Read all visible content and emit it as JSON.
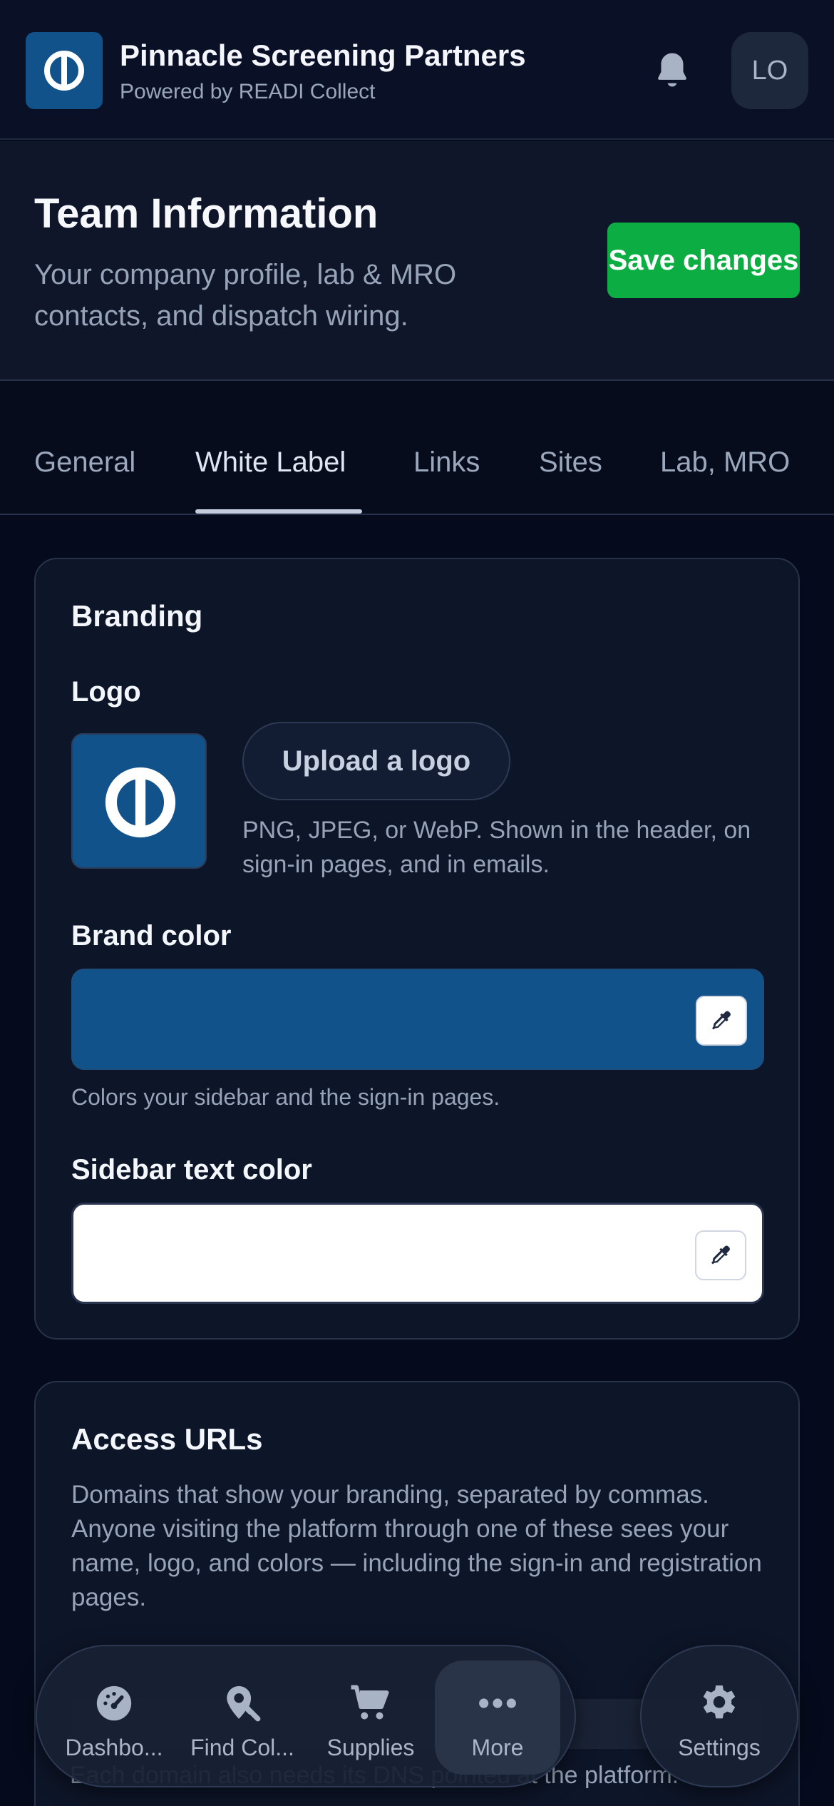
{
  "header": {
    "org_name": "Pinnacle Screening Partners",
    "org_subtitle": "Powered by READI Collect",
    "avatar_initials": "LO",
    "logo_icon": "readi-logo-icon",
    "notification_icon": "bell-icon"
  },
  "page": {
    "title": "Team Information",
    "description": "Your company profile, lab & MRO contacts, and dispatch wiring.",
    "save_label": "Save changes"
  },
  "tabs": [
    {
      "label": "General",
      "active": false
    },
    {
      "label": "White Label",
      "active": true
    },
    {
      "label": "Links",
      "active": false
    },
    {
      "label": "Sites",
      "active": false
    },
    {
      "label": "Lab, MRO",
      "active": false
    }
  ],
  "branding": {
    "title": "Branding",
    "logo_label": "Logo",
    "upload_label": "Upload a logo",
    "logo_hint": "PNG, JPEG, or WebP. Shown in the header, on sign-in pages, and in emails.",
    "brand_color_label": "Brand color",
    "brand_color_value": "#11528a",
    "brand_color_hint": "Colors your sidebar and the sign-in pages.",
    "sidebar_text_color_label": "Sidebar text color",
    "sidebar_text_color_value": "#ffffff",
    "picker_icon": "eyedropper-icon"
  },
  "access_urls": {
    "title": "Access URLs",
    "description": "Domains that show your branding, separated by commas. Anyone visiting the platform through one of these sees your name, logo, and colors — including the sign-in and registration pages.",
    "footer_hint": "Each domain also needs its DNS pointed at the platform."
  },
  "bottom_nav": {
    "items": [
      {
        "label": "Dashbo...",
        "icon": "gauge-icon",
        "active": false
      },
      {
        "label": "Find Col...",
        "icon": "map-search-icon",
        "active": false
      },
      {
        "label": "Supplies",
        "icon": "cart-icon",
        "active": false
      },
      {
        "label": "More",
        "icon": "more-dots-icon",
        "active": true
      }
    ],
    "settings": {
      "label": "Settings",
      "icon": "gear-icon"
    }
  },
  "colors": {
    "accent_green": "#0cad43",
    "brand_blue": "#11528a",
    "background": "#050b1c"
  }
}
